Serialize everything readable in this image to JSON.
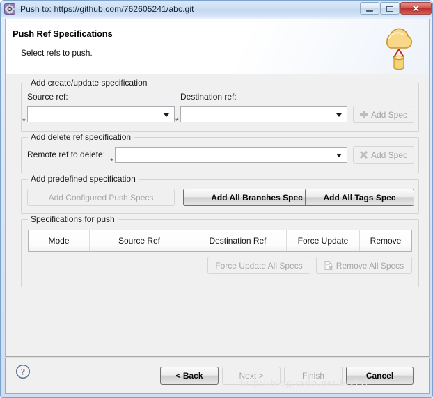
{
  "window": {
    "title": "Push to: https://github.com/762605241/abc.git",
    "app_icon": "eclipse-gear-icon",
    "controls": {
      "minimize": "minimize-icon",
      "maximize": "maximize-icon",
      "close": "✕"
    }
  },
  "header": {
    "title": "Push Ref Specifications",
    "subtitle": "Select refs to push.",
    "icon": "cloud-push-upload-icon"
  },
  "groups": {
    "create": {
      "title": "Add create/update specification",
      "source_label": "Source ref:",
      "destination_label": "Destination ref:",
      "source_value": "",
      "destination_value": "",
      "required_marker": "*",
      "add_button": "Add Spec",
      "add_button_icon": "plus-icon"
    },
    "delete": {
      "title": "Add delete ref specification",
      "remote_label": "Remote ref to delete:",
      "remote_value": "",
      "required_marker": "*",
      "add_button": "Add Spec",
      "add_button_icon": "x-mark-icon"
    },
    "predefined": {
      "title": "Add predefined specification",
      "buttons": [
        {
          "label": "Add Configured Push Specs",
          "enabled": false
        },
        {
          "label": "Add All Branches Spec",
          "enabled": true
        },
        {
          "label": "Add All Tags Spec",
          "enabled": true
        }
      ]
    },
    "specs": {
      "title": "Specifications for push",
      "columns": [
        "Mode",
        "Source Ref",
        "Destination Ref",
        "Force Update",
        "Remove"
      ],
      "rows": [],
      "force_update_all": "Force Update All Specs",
      "remove_all": "Remove All Specs",
      "remove_all_icon": "document-delete-icon"
    }
  },
  "bottom": {
    "help_icon": "help-question-icon",
    "buttons": [
      {
        "label": "< Back",
        "enabled": true
      },
      {
        "label": "Next >",
        "enabled": false
      },
      {
        "label": "Finish",
        "enabled": false
      },
      {
        "label": "Cancel",
        "enabled": true
      }
    ]
  },
  "watermark": "http://blog.csdn.net/biglxl",
  "colors": {
    "accent": "#7ba2cc",
    "close_red": "#b6302a",
    "cloud_yellow": "#f6d37a",
    "arrow_red": "#cc2222",
    "required_star": "#3c5a78"
  }
}
